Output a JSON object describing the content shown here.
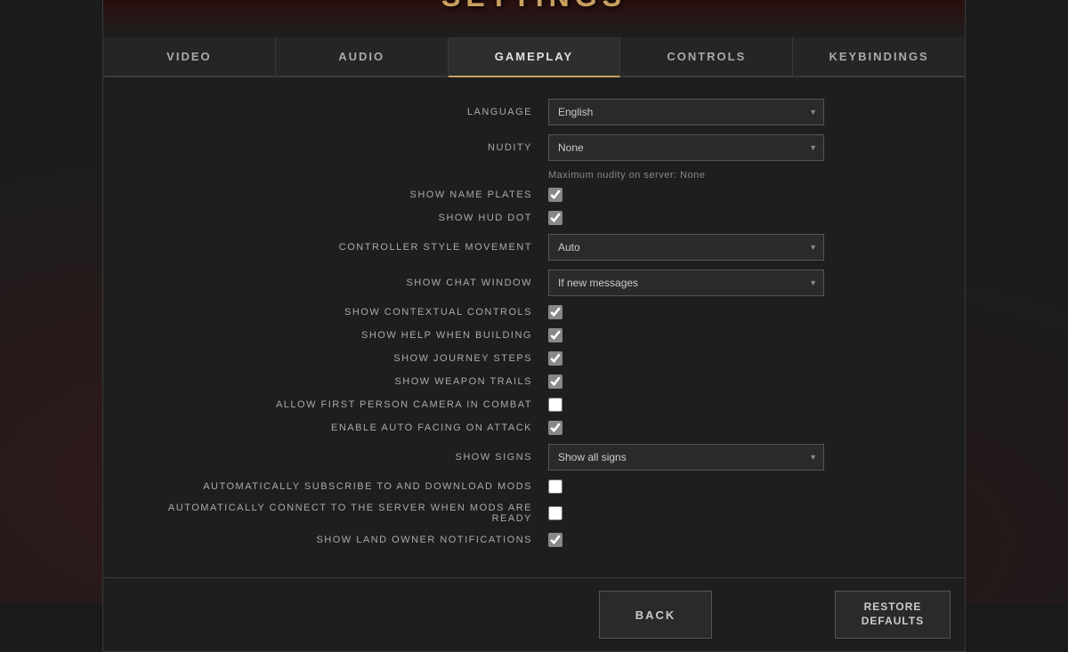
{
  "modal": {
    "title": "SETTINGS"
  },
  "close": "✕",
  "tabs": [
    {
      "id": "video",
      "label": "VIDEO",
      "active": false
    },
    {
      "id": "audio",
      "label": "AUDIO",
      "active": false
    },
    {
      "id": "gameplay",
      "label": "GAMEPLAY",
      "active": true
    },
    {
      "id": "controls",
      "label": "CONTROLS",
      "active": false
    },
    {
      "id": "keybindings",
      "label": "KEYBINDINGS",
      "active": false
    }
  ],
  "settings": {
    "language": {
      "label": "LANGUAGE",
      "value": "English"
    },
    "nudity": {
      "label": "NUDITY",
      "value": "None",
      "hint": "Maximum nudity on server: None"
    },
    "showNamePlates": {
      "label": "SHOW NAME PLATES",
      "checked": true
    },
    "showHudDot": {
      "label": "SHOW HUD DOT",
      "checked": true
    },
    "controllerStyleMovement": {
      "label": "CONTROLLER STYLE MOVEMENT",
      "value": "Auto"
    },
    "showChatWindow": {
      "label": "SHOW CHAT WINDOW",
      "value": "If new messages"
    },
    "showContextualControls": {
      "label": "SHOW CONTEXTUAL CONTROLS",
      "checked": true
    },
    "showHelpWhenBuilding": {
      "label": "SHOW HELP WHEN BUILDING",
      "checked": true
    },
    "showJourneySteps": {
      "label": "SHOW JOURNEY STEPS",
      "checked": true
    },
    "showWeaponTrails": {
      "label": "SHOW WEAPON TRAILS",
      "checked": true
    },
    "allowFirstPersonCameraInCombat": {
      "label": "ALLOW FIRST PERSON CAMERA IN COMBAT",
      "checked": false
    },
    "enableAutoFacingOnAttack": {
      "label": "ENABLE AUTO FACING ON ATTACK",
      "checked": true
    },
    "showSigns": {
      "label": "SHOW SIGNS",
      "value": "Show all signs"
    },
    "autoSubscribeToMods": {
      "label": "AUTOMATICALLY SUBSCRIBE TO AND DOWNLOAD MODS",
      "checked": false
    },
    "autoConnectWhenModsReady": {
      "label": "AUTOMATICALLY CONNECT TO THE SERVER WHEN MODS ARE READY",
      "checked": false
    },
    "showLandOwnerNotifications": {
      "label": "SHOW LAND OWNER NOTIFICATIONS",
      "checked": true
    }
  },
  "footer": {
    "back_label": "BACK",
    "restore_label": "RESTORE\nDEFAULTS"
  }
}
